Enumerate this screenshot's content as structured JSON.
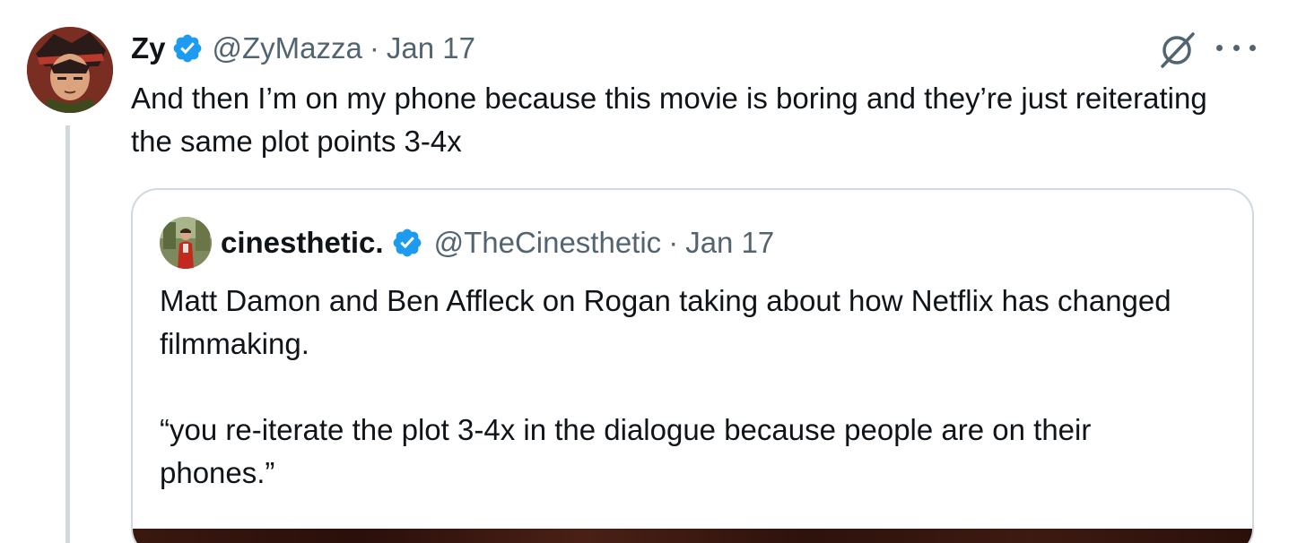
{
  "tweet": {
    "author_name": "Zy",
    "author_handle": "@ZyMazza",
    "separator": "·",
    "date": "Jan 17",
    "text": "And then I’m on my phone because this movie is boring and they’re just reiterating the same plot points 3-4x"
  },
  "quoted_tweet": {
    "author_name": "cinesthetic.",
    "author_handle": "@TheCinesthetic",
    "separator": "·",
    "date": "Jan 17",
    "paragraphs": [
      "Matt Damon and Ben Affleck on Rogan taking about how Netflix has changed filmmaking.",
      "“you re-iterate the plot 3-4x in the dialogue because people are on their phones.”"
    ]
  },
  "icons": {
    "verified": "verified-badge-icon",
    "grok": "grok-icon",
    "more": "more-options-icon"
  },
  "colors": {
    "text_primary": "#0f1419",
    "text_secondary": "#536471",
    "verified_blue": "#1d9bf0",
    "border": "#cfd9de"
  }
}
